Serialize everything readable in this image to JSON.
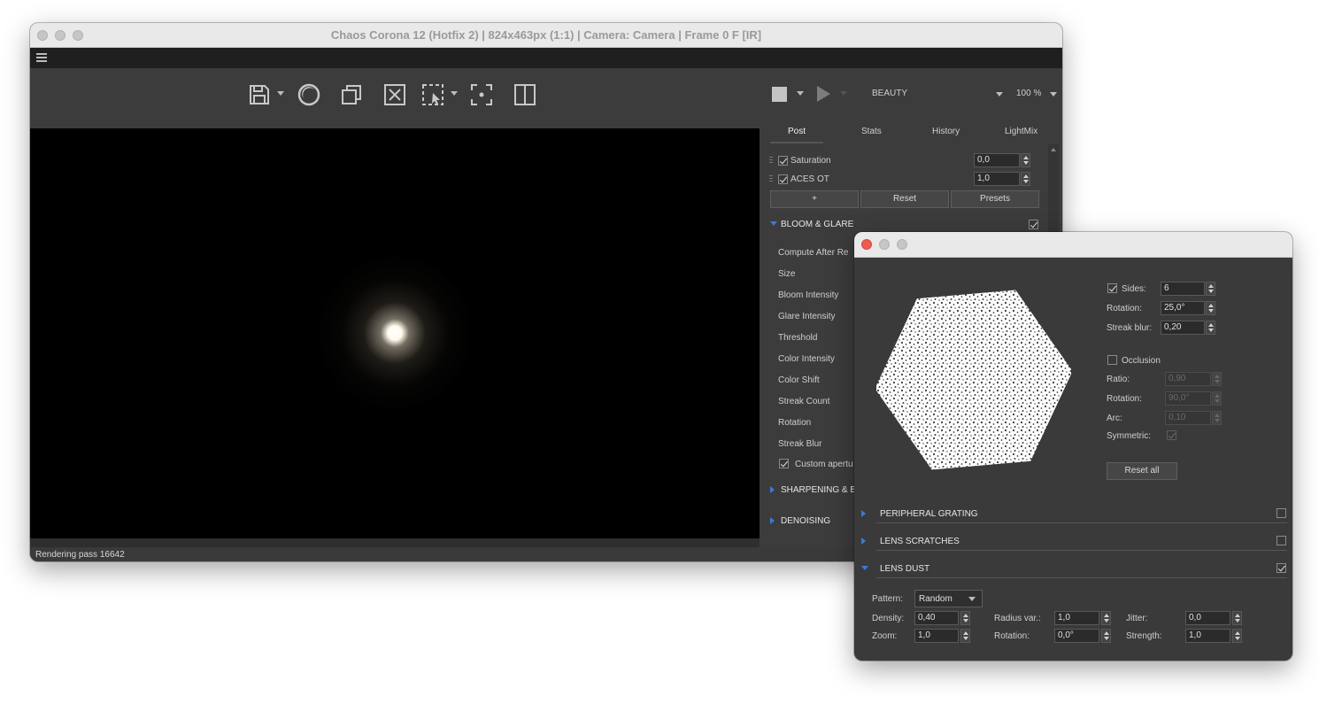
{
  "main_window": {
    "title": "Chaos Corona 12 (Hotfix 2) | 824x463px (1:1) | Camera: Camera | Frame 0 F [IR]",
    "menu_icon": "hamburger-icon",
    "toolbar": {
      "icons": [
        "save-icon",
        "corona-logo-icon",
        "copy-icon",
        "clear-icon",
        "region-select-icon",
        "focus-icon",
        "split-view-icon"
      ],
      "stop_icon": "stop-icon",
      "play_icon": "play-icon",
      "channel": "BEAUTY",
      "zoom": "100 %"
    },
    "status": "Rendering pass 16642"
  },
  "post_panel": {
    "tabs": [
      "Post",
      "Stats",
      "History",
      "LightMix"
    ],
    "active_tab": "Post",
    "rows": [
      {
        "label": "Saturation",
        "checked": true,
        "value": "0,0"
      },
      {
        "label": "ACES OT",
        "checked": true,
        "value": "1,0"
      }
    ],
    "buttons": {
      "add": "+",
      "reset": "Reset",
      "presets": "Presets"
    },
    "bloom_section": {
      "title": "BLOOM & GLARE",
      "enabled": true,
      "items": [
        "Compute After Re",
        "Size",
        "Bloom Intensity",
        "Glare Intensity",
        "Threshold",
        "Color Intensity",
        "Color Shift",
        "Streak Count",
        "Rotation",
        "Streak Blur"
      ],
      "custom_aperture": "Custom apertu",
      "custom_aperture_checked": true
    },
    "sharpening_section": "SHARPENING & B",
    "denoising_section": "DENOISING"
  },
  "aperture_window": {
    "sides": {
      "label": "Sides:",
      "checked": true,
      "value": "6"
    },
    "rotation": {
      "label": "Rotation:",
      "value": "25,0°"
    },
    "streak_blur": {
      "label": "Streak blur:",
      "value": "0,20"
    },
    "occlusion": {
      "label": "Occlusion",
      "checked": false
    },
    "ratio": {
      "label": "Ratio:",
      "value": "0,90"
    },
    "occ_rotation": {
      "label": "Rotation:",
      "value": "90,0°"
    },
    "arc": {
      "label": "Arc:",
      "value": "0,10"
    },
    "symmetric": {
      "label": "Symmetric:",
      "checked": true
    },
    "reset_all": "Reset all",
    "sections": [
      {
        "title": "PERIPHERAL GRATING",
        "checked": false,
        "expanded": false
      },
      {
        "title": "LENS SCRATCHES",
        "checked": false,
        "expanded": false
      },
      {
        "title": "LENS DUST",
        "checked": true,
        "expanded": true
      }
    ],
    "lens_dust": {
      "pattern_label": "Pattern:",
      "pattern_value": "Random",
      "density_label": "Density:",
      "density_value": "0,40",
      "zoom_label": "Zoom:",
      "zoom_value": "1,0",
      "radius_var_label": "Radius var.:",
      "radius_var_value": "1,0",
      "rotation_label": "Rotation:",
      "rotation_value": "0,0°",
      "jitter_label": "Jitter:",
      "jitter_value": "0,0",
      "strength_label": "Strength:",
      "strength_value": "1,0"
    }
  }
}
